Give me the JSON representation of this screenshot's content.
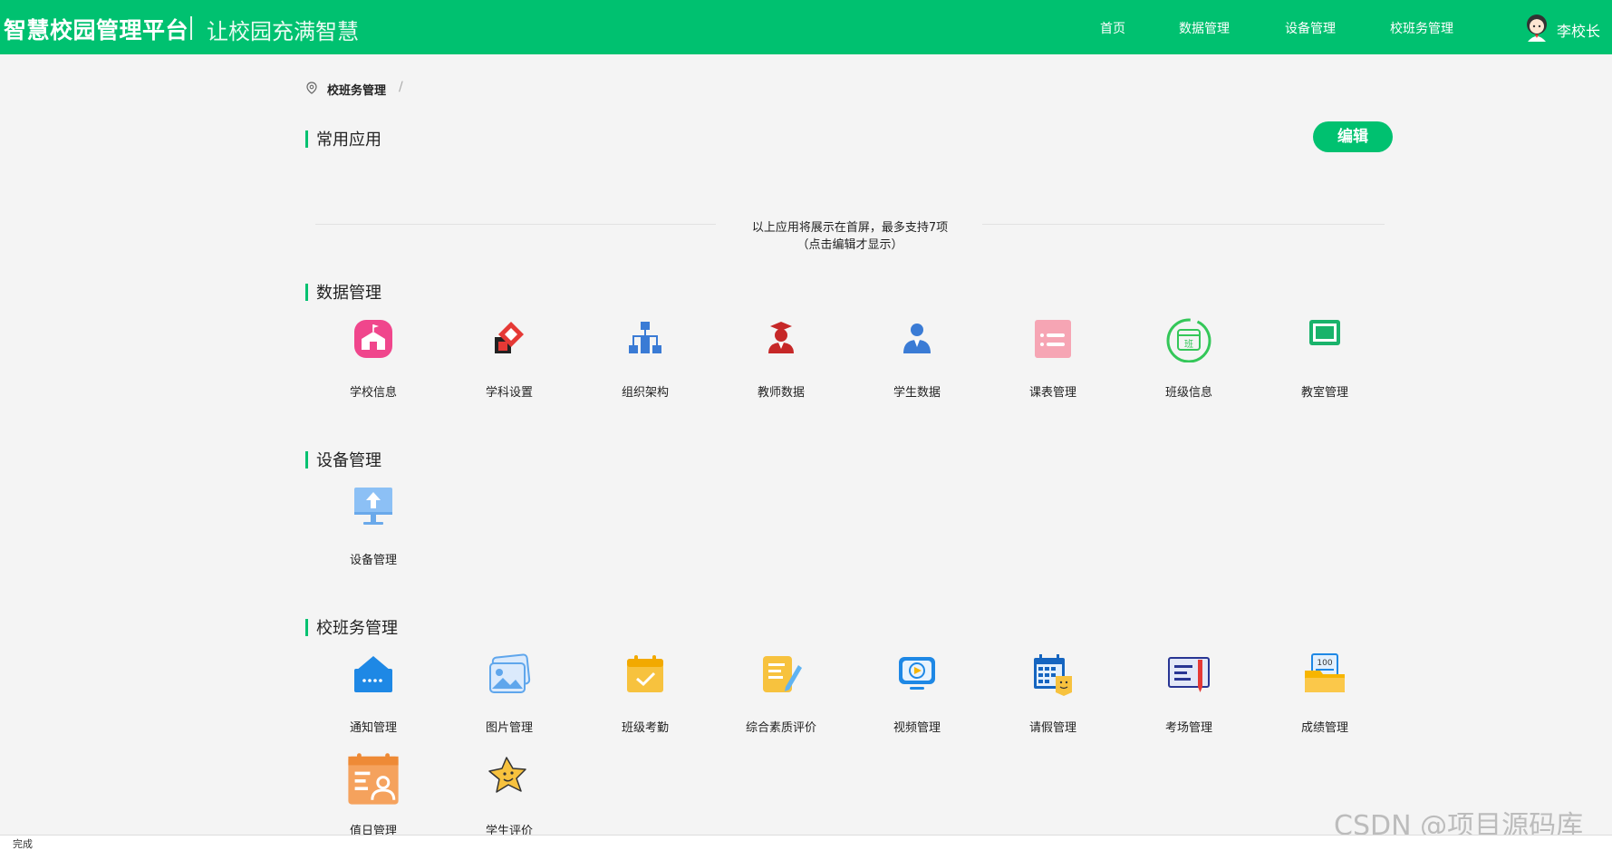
{
  "header": {
    "brand": "智慧校园管理平台",
    "slogan": "让校园充满智慧",
    "nav": [
      "首页",
      "数据管理",
      "设备管理",
      "校班务管理"
    ],
    "user": "李校长",
    "colors": {
      "primary": "#00c170"
    }
  },
  "breadcrumb": {
    "current": "校班务管理",
    "separator": "/"
  },
  "common_apps": {
    "title": "常用应用",
    "edit_label": "编辑",
    "hint_line1": "以上应用将展示在首屏，最多支持7项",
    "hint_line2": "（点击编辑才显示）"
  },
  "data_section": {
    "title": "数据管理",
    "apps": [
      {
        "label": "学校信息",
        "icon": "school-icon"
      },
      {
        "label": "学科设置",
        "icon": "subject-icon"
      },
      {
        "label": "组织架构",
        "icon": "org-chart-icon"
      },
      {
        "label": "教师数据",
        "icon": "teacher-icon"
      },
      {
        "label": "学生数据",
        "icon": "student-icon"
      },
      {
        "label": "课表管理",
        "icon": "timetable-icon"
      },
      {
        "label": "班级信息",
        "icon": "class-icon"
      },
      {
        "label": "教室管理",
        "icon": "classroom-icon"
      }
    ]
  },
  "device_section": {
    "title": "设备管理",
    "apps": [
      {
        "label": "设备管理",
        "icon": "device-icon"
      }
    ]
  },
  "affairs_section": {
    "title": "校班务管理",
    "apps": [
      {
        "label": "通知管理",
        "icon": "notice-icon"
      },
      {
        "label": "图片管理",
        "icon": "image-icon"
      },
      {
        "label": "班级考勤",
        "icon": "attendance-icon"
      },
      {
        "label": "综合素质评价",
        "icon": "quality-eval-icon"
      },
      {
        "label": "视频管理",
        "icon": "video-icon"
      },
      {
        "label": "请假管理",
        "icon": "leave-icon"
      },
      {
        "label": "考场管理",
        "icon": "exam-room-icon"
      },
      {
        "label": "成绩管理",
        "icon": "score-icon"
      },
      {
        "label": "值日管理",
        "icon": "duty-icon"
      },
      {
        "label": "学生评价",
        "icon": "student-eval-icon"
      }
    ]
  },
  "status": {
    "text": "完成"
  },
  "watermark": "CSDN @项目源码库"
}
